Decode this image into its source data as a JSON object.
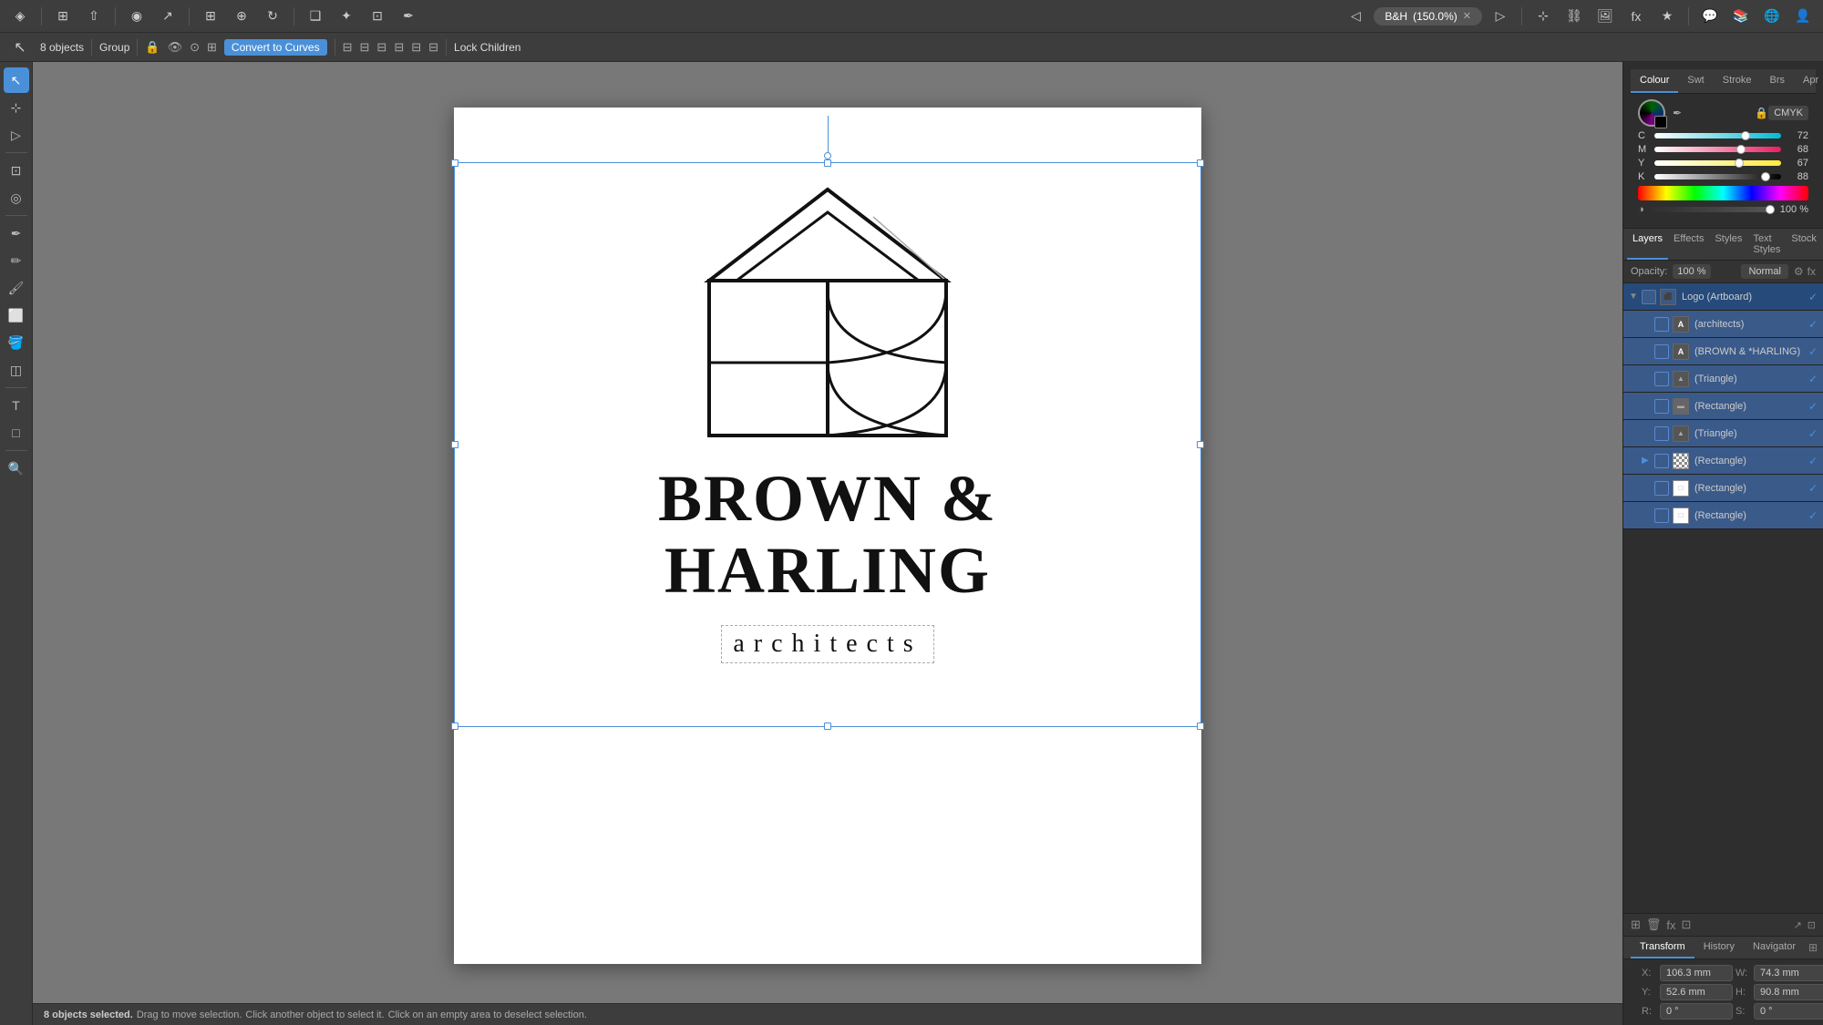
{
  "app": {
    "title": "B&H",
    "zoom": "150.0%"
  },
  "top_toolbar": {
    "tools": [
      {
        "name": "affinity-logo",
        "icon": "◈"
      },
      {
        "name": "new-doc",
        "icon": "⊞"
      },
      {
        "name": "share",
        "icon": "⇧"
      },
      {
        "name": "place",
        "icon": "◎"
      },
      {
        "name": "export",
        "icon": "↗"
      },
      {
        "name": "grid",
        "icon": "⊞"
      },
      {
        "name": "snapping",
        "icon": "⊕"
      },
      {
        "name": "rotate",
        "icon": "↻"
      },
      {
        "name": "arrange",
        "icon": "❑"
      },
      {
        "name": "transform",
        "icon": "✦"
      },
      {
        "name": "crop",
        "icon": "⊡"
      },
      {
        "name": "pen",
        "icon": "✒"
      },
      {
        "name": "draw",
        "icon": "✏"
      },
      {
        "name": "brush",
        "icon": "🖌"
      },
      {
        "name": "pencil",
        "icon": "✐"
      },
      {
        "name": "zoom-out",
        "icon": "◁"
      },
      {
        "name": "zoom-text",
        "icon": "B&H (150.0%)"
      },
      {
        "name": "zoom-close",
        "icon": "✕"
      },
      {
        "name": "zoom-in",
        "icon": "▷"
      }
    ]
  },
  "context_toolbar": {
    "objects_count": "8 objects",
    "group_label": "Group",
    "convert_btn": "Convert to Curves",
    "lock_children": "Lock Children"
  },
  "colour_panel": {
    "tabs": [
      "Colour",
      "Swt",
      "Stroke",
      "Brs",
      "Apr"
    ],
    "active_tab": "Colour",
    "mode": "CMYK",
    "channels": [
      {
        "label": "C",
        "value": 72,
        "percent": 0.72
      },
      {
        "label": "M",
        "value": 68,
        "percent": 0.68
      },
      {
        "label": "Y",
        "value": 67,
        "percent": 0.67
      },
      {
        "label": "K",
        "value": 88,
        "percent": 0.88
      }
    ],
    "opacity_label": "Opacity",
    "opacity_value": "100 %"
  },
  "layers_panel": {
    "tabs": [
      "Layers",
      "Effects",
      "Styles",
      "Text Styles",
      "Stock"
    ],
    "active_tab": "Layers",
    "opacity_label": "Opacity:",
    "opacity_value": "100 %",
    "blend_mode": "Normal",
    "items": [
      {
        "name": "Logo (Artboard)",
        "type": "artboard",
        "visible": true,
        "checked": true,
        "indent": 0
      },
      {
        "name": "(architects)",
        "type": "text",
        "visible": true,
        "checked": true,
        "indent": 1
      },
      {
        "name": "(BROWN & *HARLING)",
        "type": "text",
        "visible": true,
        "checked": true,
        "indent": 1
      },
      {
        "name": "(Triangle)",
        "type": "triangle",
        "visible": true,
        "checked": true,
        "indent": 1
      },
      {
        "name": "(Rectangle)",
        "type": "rectangle",
        "visible": true,
        "checked": true,
        "indent": 1
      },
      {
        "name": "(Triangle)",
        "type": "triangle",
        "visible": true,
        "checked": true,
        "indent": 1
      },
      {
        "name": "(Rectangle)",
        "type": "rectangle-group",
        "visible": true,
        "checked": true,
        "indent": 1
      },
      {
        "name": "(Rectangle)",
        "type": "rectangle",
        "visible": true,
        "checked": true,
        "indent": 1
      },
      {
        "name": "(Rectangle)",
        "type": "rectangle",
        "visible": true,
        "checked": true,
        "indent": 1
      }
    ]
  },
  "bottom_panel": {
    "tabs": [
      "Transform",
      "History",
      "Navigator"
    ],
    "active_tab": "Transform",
    "x": "X: 106.3 mm",
    "y": "Y: 52.6 mm",
    "w": "W: 74.3 mm",
    "h": "H: 90.8 mm",
    "r": "R: 0 °",
    "s": "S: 0 °"
  },
  "status_bar": {
    "message": "8 objects selected.",
    "drag_hint": "Drag to move selection.",
    "click_hint1": "Click another object to select it.",
    "click_hint2": "Click on an empty area to deselect selection."
  },
  "logo": {
    "main_text": "BROWN &\nHARLING",
    "sub_text": "architects",
    "line1": "BROWN &",
    "line2": "HARLING"
  }
}
